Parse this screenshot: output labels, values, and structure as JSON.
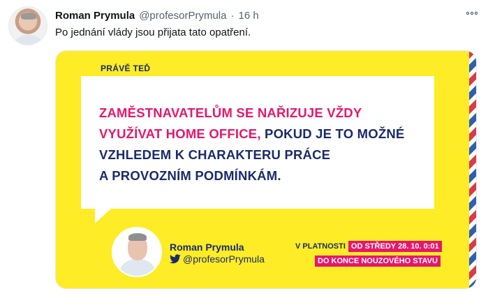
{
  "tweet": {
    "author_name": "Roman Prymula",
    "author_handle": "@profesorPrymula",
    "separator": "·",
    "time": "16 h",
    "text": "Po jednání vlády jsou přijata tato opatření.",
    "more_icon": "more-dots-icon"
  },
  "media": {
    "label": "PRÁVĚ TEĎ",
    "quote": {
      "line1": "ZAMĚSTNAVATELŮM SE NAŘIZUJE VŽDY",
      "line2_pink": "VYUŽÍVAT HOME OFFICE,",
      "line2_navy": " POKUD JE TO MOŽNÉ",
      "line3": "VZHLEDEM K CHARAKTERU PRÁCE",
      "line4": "A PROVOZNÍM PODMÍNKÁM."
    },
    "card_name": "Roman Prymula",
    "card_handle": "@profesorPrymula",
    "validity_label": "V PLATNOSTI",
    "validity_from": "OD STŘEDY 28. 10. 0:01",
    "validity_until": "DO KONCE NOUZOVÉHO STAVU"
  },
  "colors": {
    "background_yellow": "#fdec26",
    "pink": "#e6176b",
    "navy": "#1a2b6b"
  }
}
